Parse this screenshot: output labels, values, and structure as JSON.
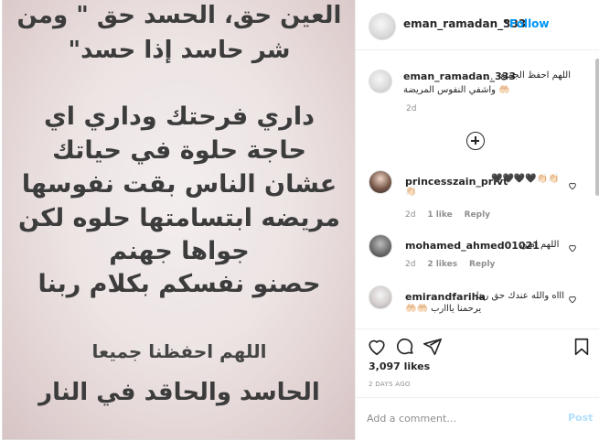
{
  "post_image": {
    "lines": [
      "العين حق، الحسد حق \" ومن",
      "شر حاسد إذا حسد\"",
      "داري فرحتك وداري اي",
      "حاجة حلوة في حياتك",
      "عشان الناس بقت نفوسها",
      "مريضه ابتسامتها حلوه لكن",
      "جواها جهنم",
      "حصنو نفسكم بكلام ربنا",
      "اللهم احفظنا جميعا",
      "الحاسد والحاقد في النار"
    ]
  },
  "header": {
    "username": "eman_ramadan_333",
    "separator": "•",
    "follow_label": "Follow"
  },
  "caption": {
    "username": "eman_ramadan_333",
    "dots": "...",
    "text_line1": "اللهم احفظ الجميع",
    "text_line2": "🤲🏻 واشفي النفوس المريضة",
    "time": "2d"
  },
  "comments": [
    {
      "username": "princesszain_privt",
      "text": "🖤🖤🖤🖤👏🏻👏🏻",
      "text2": "👏🏻",
      "time": "2d",
      "likes": "1 like",
      "reply": "Reply"
    },
    {
      "username": "mohamed_ahmed01021",
      "text": "اللهم امين",
      "time": "2d",
      "likes": "2 likes",
      "reply": "Reply"
    },
    {
      "username": "emirandfariha",
      "text": "اااه والله عندك حق ربنا",
      "text2": "يرحمنا يااارب 🤲🏻🤲🏻"
    }
  ],
  "actions": {
    "likes_count": "3,097 likes",
    "date": "2 DAYS AGO"
  },
  "add_comment": {
    "placeholder": "Add a comment…",
    "post_label": "Post"
  },
  "colors": {
    "accent": "#0095f6",
    "post_disabled": "#b2dffc",
    "muted": "#8e8e8e",
    "text": "#262626"
  }
}
